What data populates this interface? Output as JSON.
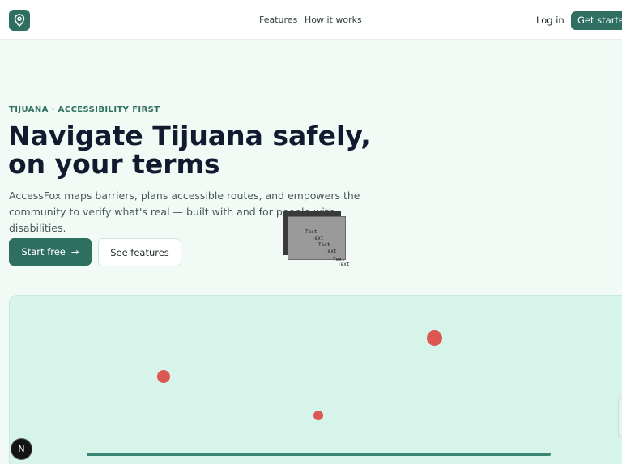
{
  "nav": {
    "links": [
      "Features",
      "How it works"
    ],
    "login_label": "Log in",
    "cta_label": "Get started"
  },
  "hero": {
    "eyebrow": "TIJUANA · ACCESSIBILITY FIRST",
    "headline": "Navigate Tijuana safely, on your terms",
    "subtext": "AccessFox maps barriers, plans accessible routes, and empowers the community to verify what's real — built with and for people with disabilities.",
    "primary_button": "Start free",
    "primary_button_arrow": "→",
    "secondary_button": "See features"
  },
  "overlay": {
    "glitch_text": "Text"
  },
  "floating": {
    "badge_letter": "N"
  },
  "colors": {
    "accent": "#2f6f62",
    "map_background": "#d6f4ea",
    "marker": "#dc5752"
  },
  "icons": {
    "logo": "map-pin-icon",
    "arrow": "arrow-right-icon"
  }
}
